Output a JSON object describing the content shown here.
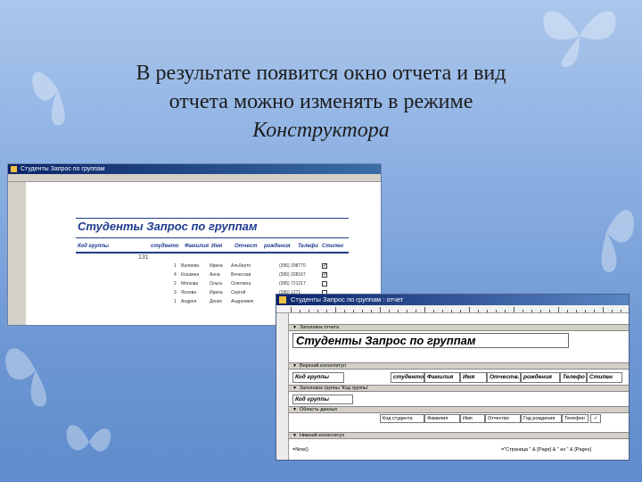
{
  "slide": {
    "line1": "В результате появится окно отчета  и вид",
    "line2": "отчета можно изменять в режиме",
    "line3": "Конструктора"
  },
  "report_window": {
    "title": "Студенты Запрос по группам",
    "report_title": "Студенты Запрос по группам",
    "headers": [
      "Код группы",
      "студенто",
      "Фамилия",
      "Имя",
      "Отчест",
      "рождения",
      "Телефо",
      "Стипен"
    ],
    "group_value": "131",
    "rows": [
      {
        "num": "1",
        "last": "Валиева",
        "first": "Ирина",
        "mid": "Альберто",
        "phone": "(395) 298770",
        "checked": true
      },
      {
        "num": "4",
        "last": "Кошкина",
        "first": "Анна",
        "mid": "Вячеслав",
        "phone": "(395) 328167",
        "checked": true
      },
      {
        "num": "2",
        "last": "Мягкова",
        "first": "Ольга",
        "mid": "Олеговна",
        "phone": "(395) 721217",
        "checked": false
      },
      {
        "num": "3",
        "last": "Ясеева",
        "first": "Ирина",
        "mid": "Сергей",
        "phone": "(395) 1271",
        "checked": false
      },
      {
        "num": "1",
        "last": "Андрея",
        "first": "Денис",
        "mid": "Андреевич",
        "phone": "",
        "checked": false
      }
    ]
  },
  "design_window": {
    "title": "Студенты Запрос по группам : отчет",
    "bands": {
      "report_header": "Заголовок отчета",
      "page_header": "Верхний колонтитул",
      "group_header": "Заголовок группы 'Код группы'",
      "detail": "Область данных",
      "page_footer": "Нижний колонтитул"
    },
    "report_title": "Студенты Запрос по группам",
    "headers": [
      "Код группы",
      "студенто",
      "Фамилия",
      "Имя",
      "Отчеств.",
      "рождения",
      "Телефо",
      "Стипен"
    ],
    "group_field": "Код группы",
    "detail_fields": [
      "Код студента",
      "Фамилия",
      "Имя",
      "Отчество",
      "Год рождения",
      "Телефон"
    ],
    "footer_left": "=Now()",
    "footer_right": "=\"Страница \" & [Page] & \" из \" & [Pages]"
  }
}
